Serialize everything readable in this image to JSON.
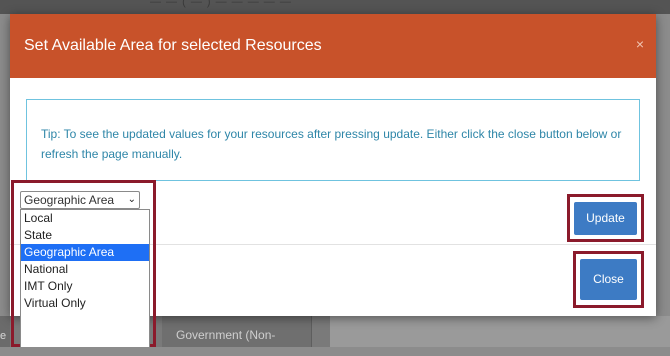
{
  "background": {
    "top_text": "— — ( — ) — — — — —",
    "left_tab_text": "e",
    "tab_text": "Government (Non-"
  },
  "modal": {
    "title": "Set Available Area for selected Resources",
    "close_glyph": "×",
    "tip": "Tip: To see the updated values for your resources after pressing update. Either click the close button below or refresh the page manually.",
    "select": {
      "value": "Geographic Area",
      "arrow": "⌄",
      "options": [
        "Local",
        "State",
        "Geographic Area",
        "National",
        "IMT Only",
        "Virtual Only"
      ],
      "selected_index": 2
    },
    "update_label": "Update",
    "close_label": "Close"
  },
  "colors": {
    "header": "#c8522a",
    "button": "#3d7bc4",
    "highlight": "#8b1a2b",
    "tip_border": "#6fc3df",
    "selected_option": "#1e6ff5"
  }
}
